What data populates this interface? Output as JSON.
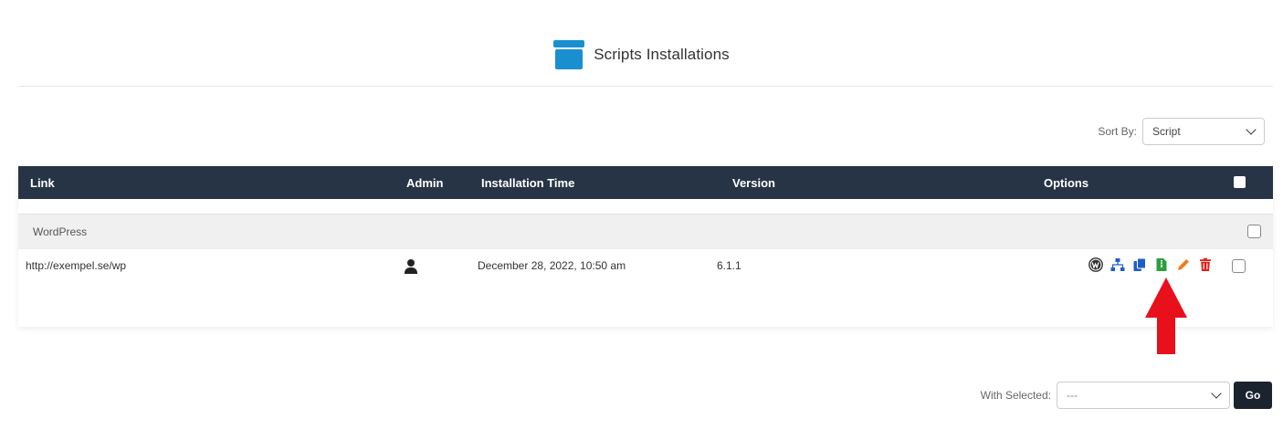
{
  "header": {
    "title": "Scripts Installations",
    "icon": "archive-icon"
  },
  "sort": {
    "label": "Sort By:",
    "value": "Script"
  },
  "table": {
    "columns": {
      "link": "Link",
      "admin": "Admin",
      "installation_time": "Installation Time",
      "version": "Version",
      "options": "Options"
    },
    "group": {
      "name": "WordPress"
    },
    "rows": [
      {
        "link": "http://exempel.se/wp",
        "admin_icon": "user-icon",
        "installation_time": "December 28, 2022, 10:50 am",
        "version": "6.1.1"
      }
    ],
    "option_icons": [
      "wordpress-icon",
      "sitemap-icon",
      "copy-icon",
      "file-zip-icon",
      "pencil-icon",
      "trash-icon"
    ]
  },
  "footer": {
    "label": "With Selected:",
    "value": "---",
    "go": "Go"
  },
  "colors": {
    "header_bg": "#263445",
    "accent_blue": "#1a8fd0",
    "green": "#2e9e3f",
    "orange": "#f07a1a",
    "red": "#e0201b",
    "arrow": "#e8101a"
  }
}
